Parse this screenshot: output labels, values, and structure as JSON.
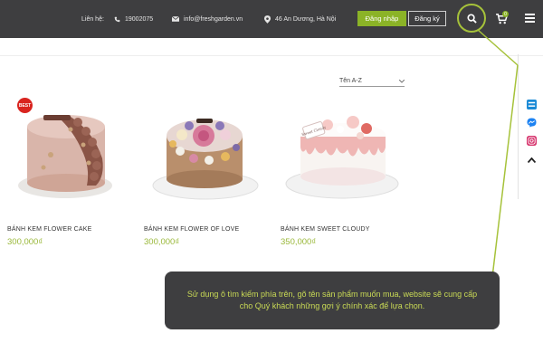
{
  "header": {
    "contact_label": "Liên hệ:",
    "phone": "19002075",
    "email": "info@freshgarden.vn",
    "address": "46 An Dương, Hà Nội",
    "login_label": "Đăng nhập",
    "register_label": "Đăng ký",
    "cart_count": "0",
    "icons": [
      "phone-icon",
      "mail-icon",
      "location-icon",
      "search-icon",
      "cart-icon",
      "menu-icon"
    ]
  },
  "sort": {
    "selected": "Tên A-Z"
  },
  "products": [
    {
      "name": "BÁNH KEM FLOWER CAKE",
      "price": "300,000₫",
      "badge": "BEST"
    },
    {
      "name": "BÁNH KEM FLOWER OF LOVE",
      "price": "300,000₫"
    },
    {
      "name": "BÁNH KEM SWEET CLOUDY",
      "price": "350,000₫",
      "plaque_text": "Sweet Cloudy"
    }
  ],
  "social": [
    "zalo-icon",
    "messenger-icon",
    "instagram-icon",
    "scroll-up-icon"
  ],
  "annotation": {
    "text": "Sử dụng ô tìm kiếm phía trên, gõ tên sản phẩm muốn mua, website sẽ cung cấp cho Quý khách những gợi ý chính xác để lựa chọn."
  },
  "colors": {
    "header_bg": "#3e3e40",
    "accent": "#8bb327",
    "price": "#9ab83a",
    "tooltip_text": "#c9da55",
    "badge": "#d9241f"
  }
}
